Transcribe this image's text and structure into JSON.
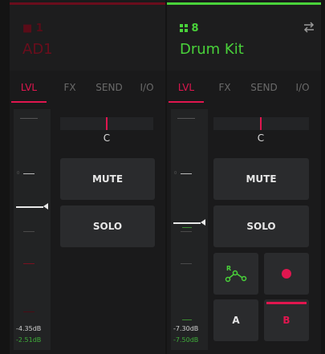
{
  "tracks": [
    {
      "number": "■ 1",
      "name": "AD1",
      "accent": "#8c1024",
      "tabs": [
        "LVL",
        "FX",
        "SEND",
        "I/O"
      ],
      "active_tab": "LVL",
      "pan_label": "C",
      "mute_label": "MUTE",
      "solo_label": "SOLO",
      "db_top": "-4.35dB",
      "db_bottom": "-2.51dB",
      "fader_level": 0.55
    },
    {
      "number": "8",
      "name": "Drum Kit",
      "accent": "#49d23a",
      "tabs": [
        "LVL",
        "FX",
        "SEND",
        "I/O"
      ],
      "active_tab": "LVL",
      "pan_label": "C",
      "mute_label": "MUTE",
      "solo_label": "SOLO",
      "automation_label": "R",
      "a_label": "A",
      "b_label": "B",
      "db_top": "-7.30dB",
      "db_bottom": "-7.50dB",
      "fader_level": 0.52
    }
  ],
  "icons": {
    "swap": "swap-arrows-icon",
    "record": "record-dot-icon",
    "automation": "automation-read-icon",
    "track": "grid-icon"
  }
}
